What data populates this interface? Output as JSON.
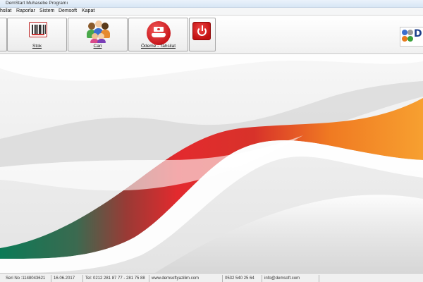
{
  "window": {
    "title": "DemStart Muhasebe Programı"
  },
  "menu": {
    "items": [
      "hsilat",
      "Raporlar",
      "Sistem",
      "Demsoft",
      "Kapat"
    ]
  },
  "toolbar": {
    "stok_label": "Stok",
    "cari_label": "Cari",
    "odeme_label": "Ödeme - Tahsilat",
    "icons": {
      "stok": "barcode-icon",
      "cari": "people-icon",
      "odeme": "payment-icon",
      "exit": "power-icon",
      "brand": "demsoft-logo"
    }
  },
  "brand": {
    "letter": "D"
  },
  "status": {
    "serial": "Seri No :1148043621",
    "date": "16.06.2017",
    "phone": "Tel: 0212 281 87 77 - 281 75 88",
    "website": "www.demsoftyazilim.com",
    "mobile": "0532 540 25 64",
    "email": "info@demsoft.com"
  },
  "colors": {
    "accent_red": "#d42a2a",
    "wave_orange": "#f7941d",
    "wave_green": "#0a7a55"
  }
}
